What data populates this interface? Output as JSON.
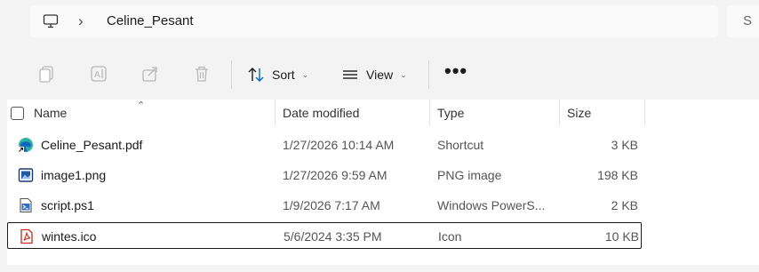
{
  "address": {
    "location": "Celine_Pesant",
    "separator": "›"
  },
  "search": {
    "hint": "S"
  },
  "toolbar": {
    "sort_label": "Sort",
    "view_label": "View",
    "more_label": "•••",
    "dropdown_glyph": "⌄"
  },
  "columns": {
    "name": "Name",
    "date": "Date modified",
    "type": "Type",
    "size": "Size"
  },
  "files": [
    {
      "name": "Celine_Pesant.pdf",
      "date": "1/27/2026 10:14 AM",
      "type": "Shortcut",
      "size": "3 KB",
      "icon": "edge-shortcut-icon"
    },
    {
      "name": "image1.png",
      "date": "1/27/2026 9:59 AM",
      "type": "PNG image",
      "size": "198 KB",
      "icon": "image-file-icon"
    },
    {
      "name": "script.ps1",
      "date": "1/9/2026 7:17 AM",
      "type": "Windows PowerS...",
      "size": "2 KB",
      "icon": "powershell-file-icon"
    },
    {
      "name": "wintes.ico",
      "date": "5/6/2024 3:35 PM",
      "type": "Icon",
      "size": "10 KB",
      "icon": "pdf-file-icon"
    }
  ],
  "colors": {
    "accent": "#0067c0",
    "pdf_red": "#c42b1c",
    "edge_teal": "#2bb5a0"
  }
}
